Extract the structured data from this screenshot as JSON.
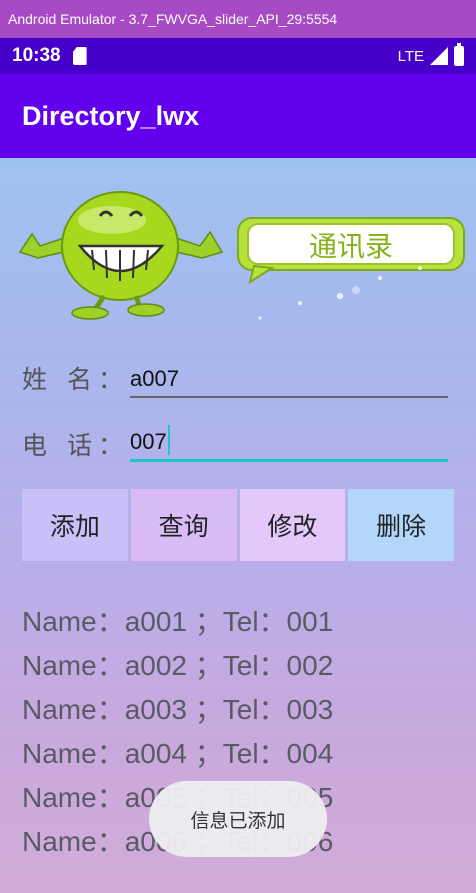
{
  "emulator": {
    "title": "Android Emulator - 3.7_FWVGA_slider_API_29:5554"
  },
  "status_bar": {
    "time": "10:38",
    "network": "LTE"
  },
  "app_bar": {
    "title": "Directory_lwx"
  },
  "banner": {
    "logo_text": "通讯录"
  },
  "form": {
    "name_label": "姓 名：",
    "name_value": "a007",
    "phone_label": "电 话：",
    "phone_value": "007"
  },
  "buttons": {
    "add": "添加",
    "query": "查询",
    "edit": "修改",
    "delete": "删除"
  },
  "contacts": [
    "Name：a001 ；Tel：001",
    "Name：a002 ；Tel：002",
    "Name：a003 ；Tel：003",
    "Name：a004 ；Tel：004",
    "Name：a005 ；Tel：005",
    "Name：a006 ；Tel：006"
  ],
  "toast": {
    "message": "信息已添加"
  },
  "colors": {
    "app_bar": "#6200ee",
    "status_bar": "#4700c9",
    "accent": "#1ac6c6"
  }
}
